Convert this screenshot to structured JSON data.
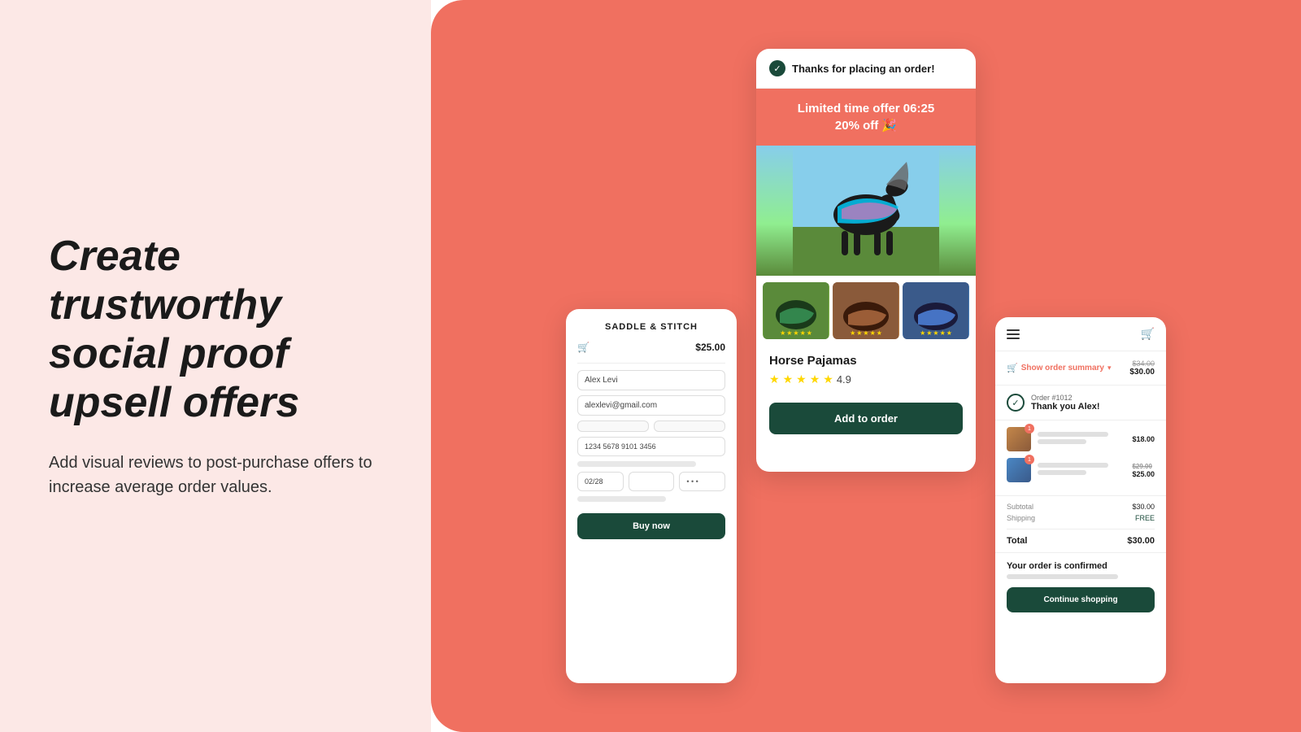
{
  "left": {
    "heading": "Create trustworthy social proof upsell offers",
    "subtext": "Add visual reviews to post-purchase offers to increase average order values."
  },
  "checkout_card": {
    "store_name": "SADDLE & STITCH",
    "price": "$25.00",
    "name_placeholder": "Alex Levi",
    "email_placeholder": "alexlevi@gmail.com",
    "card_number": "1234 5678 9101 3456",
    "expiry": "02/28",
    "buy_btn": "Buy now"
  },
  "upsell_card": {
    "header": "Thanks for placing an order!",
    "offer_line1": "Limited time offer 06:25",
    "offer_line2": "20% off 🎉",
    "product_name": "Horse Pajamas",
    "rating": "4.9",
    "add_btn": "Add to order"
  },
  "confirmed_card": {
    "order_summary": "Show order summary",
    "price_original": "$34.00",
    "price_current": "$30.00",
    "order_number": "Order #1012",
    "thank_you": "Thank you Alex!",
    "subtotal_label": "Subtotal",
    "subtotal_value": "$30.00",
    "shipping_label": "Shipping",
    "shipping_value": "FREE",
    "total_label": "Total",
    "total_value": "$30.00",
    "item1_price": "$18.00",
    "item2_price": "$25.00",
    "confirmed_text": "Your order is confirmed",
    "continue_btn": "Continue shopping"
  },
  "colors": {
    "coral": "#f07060",
    "dark_green": "#1a4a3a",
    "left_bg": "#fce8e6",
    "star": "#FFD700"
  }
}
